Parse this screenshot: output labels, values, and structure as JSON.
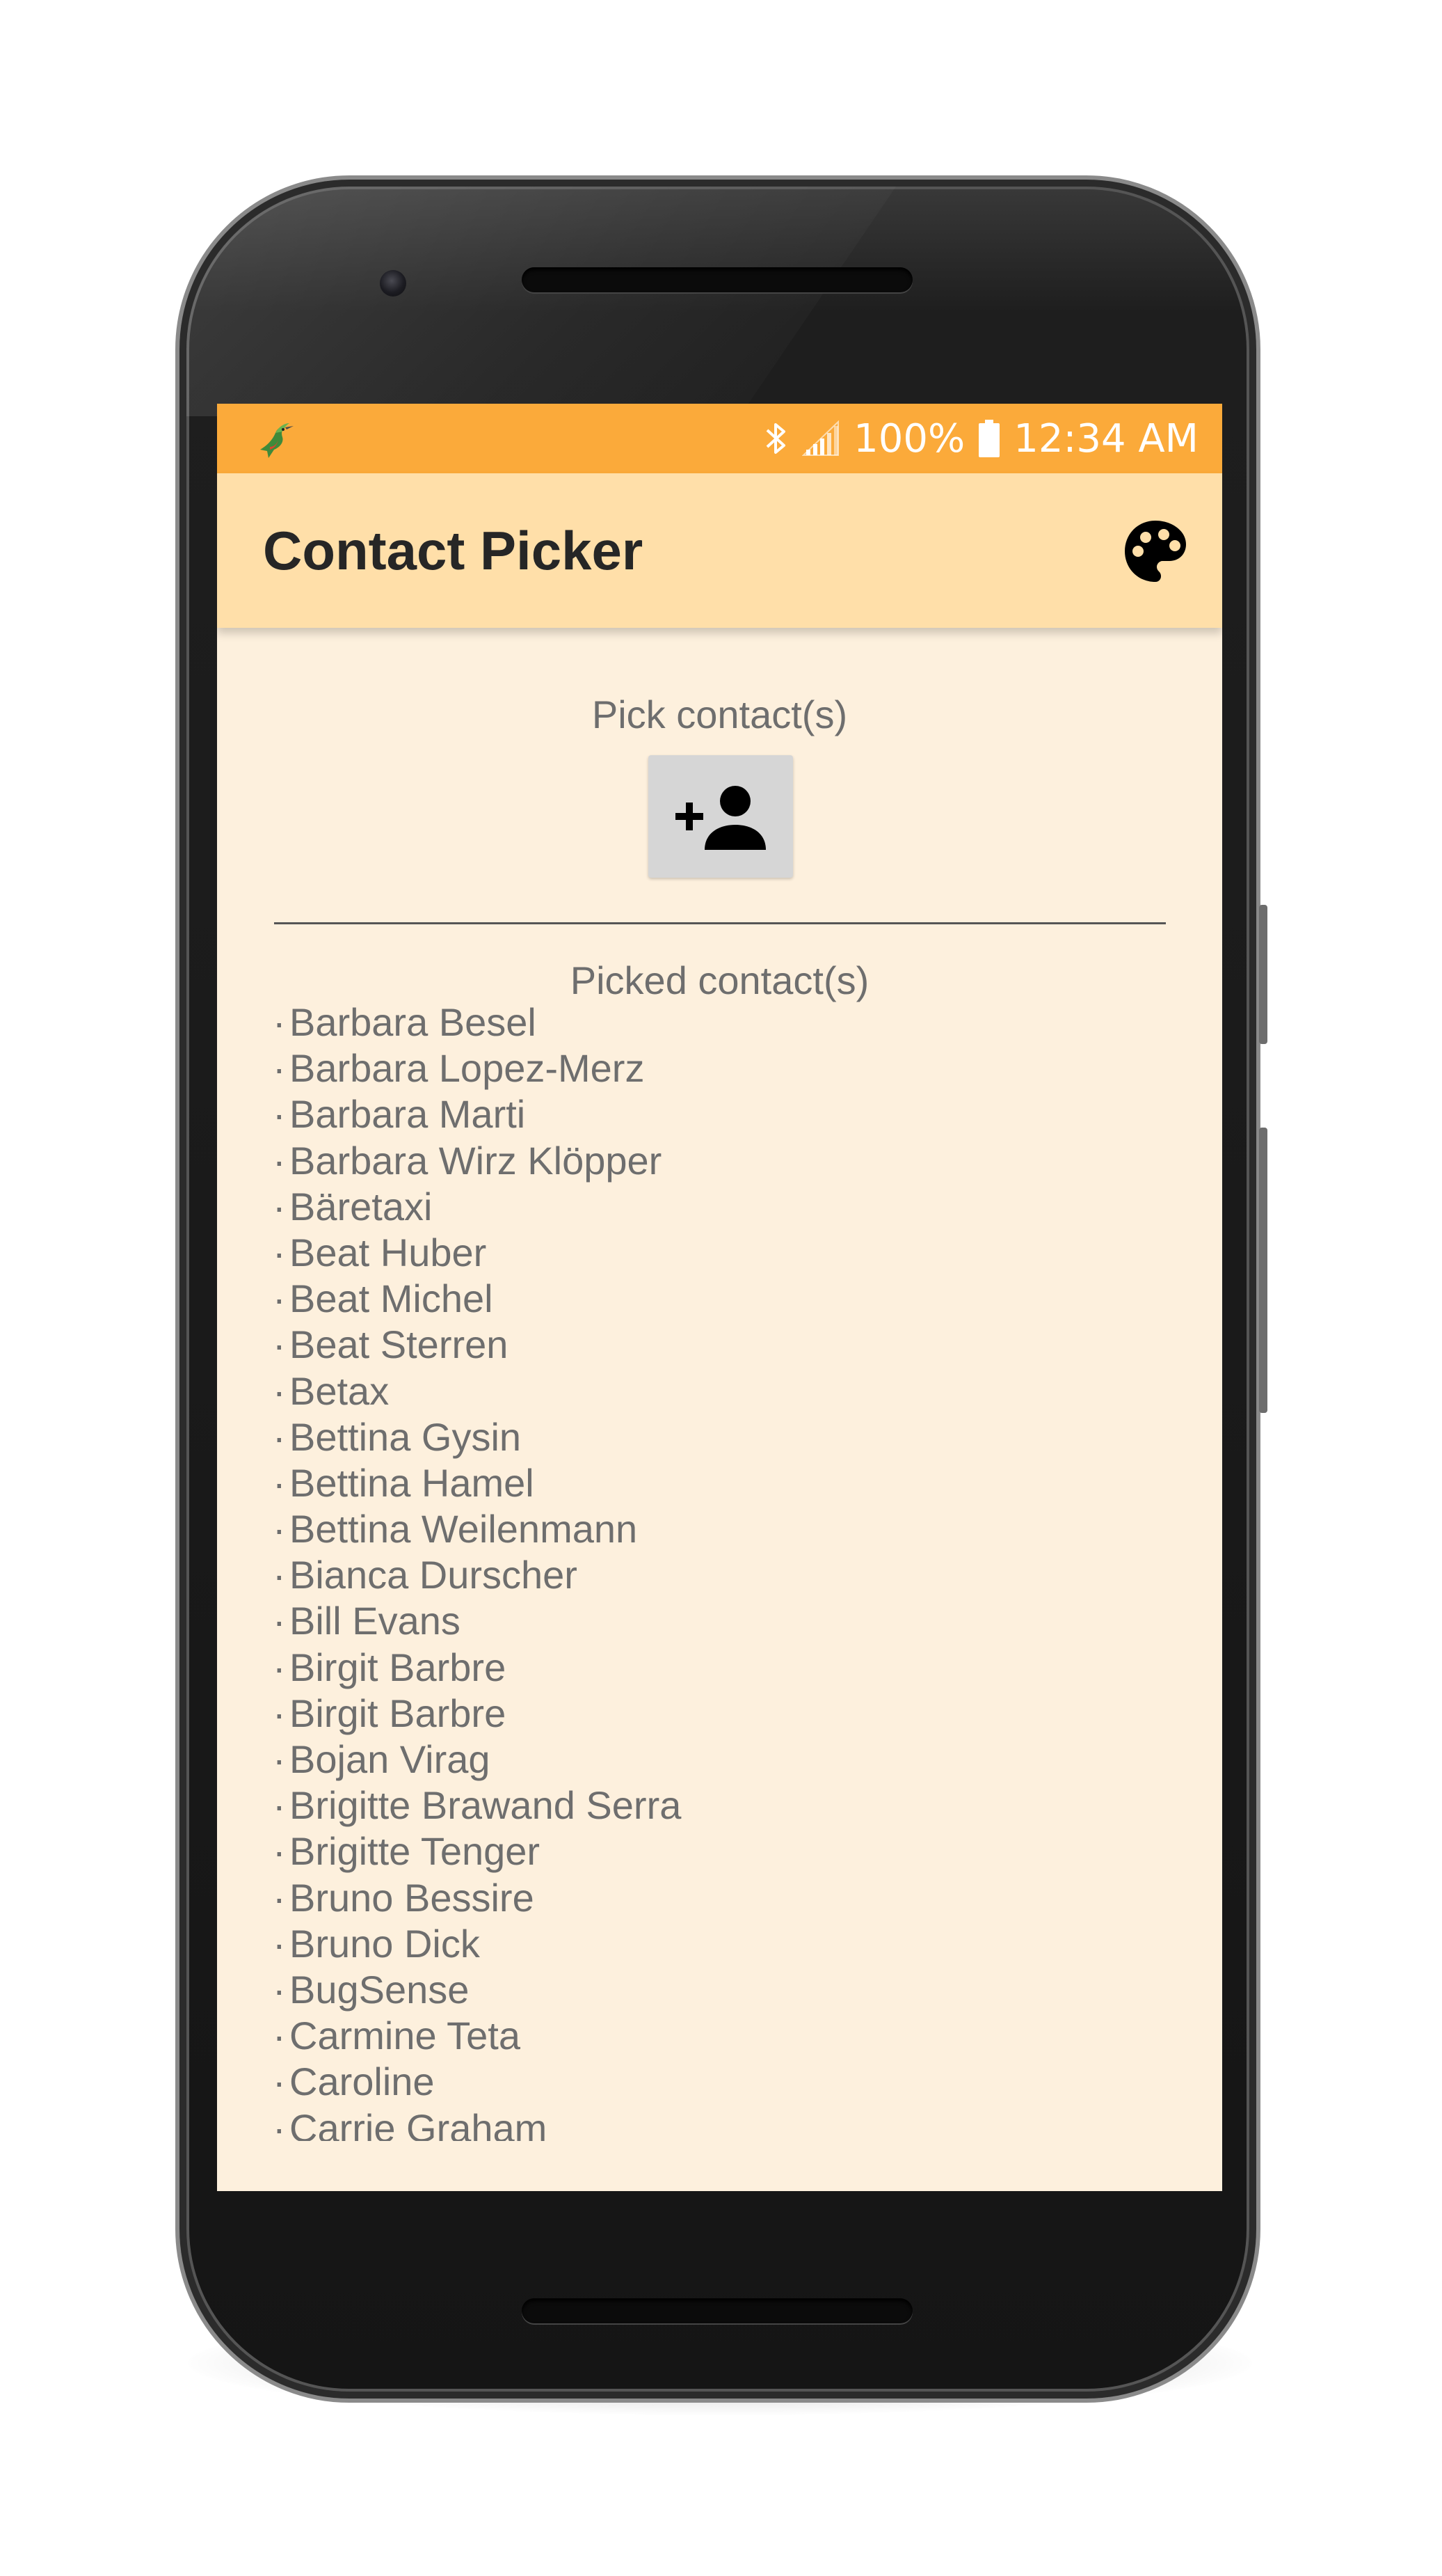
{
  "status_bar": {
    "left_icon": "hummingbird-app-icon",
    "bluetooth_icon": "bluetooth-icon",
    "signal_icon": "cell-signal-icon",
    "battery_percent": "100%",
    "battery_icon": "battery-full-icon",
    "time": "12:34 AM",
    "background_color": "#fbaa3a"
  },
  "app_bar": {
    "title": "Contact Picker",
    "palette_icon": "palette-icon",
    "background_color": "#ffdfa9"
  },
  "main": {
    "pick_label": "Pick contact(s)",
    "pick_button_icon": "add-person-icon",
    "picked_label": "Picked contact(s)",
    "bullet": "·",
    "background_color": "#fdf0dd",
    "contacts": [
      "Barbara Besel",
      "Barbara Lopez-Merz",
      "Barbara Marti",
      "Barbara Wirz Klöpper",
      "Bäretaxi",
      "Beat Huber",
      "Beat Michel",
      "Beat Sterren",
      "Betax",
      "Bettina Gysin",
      "Bettina Hamel",
      "Bettina Weilenmann",
      "Bianca Durscher",
      "Bill Evans",
      "Birgit Barbre",
      "Birgit Barbre",
      "Bojan Virag",
      "Brigitte Brawand Serra",
      "Brigitte Tenger",
      "Bruno Bessire",
      "Bruno Dick",
      "BugSense",
      "Carmine Teta",
      "Caroline",
      "Carrie Graham"
    ]
  }
}
